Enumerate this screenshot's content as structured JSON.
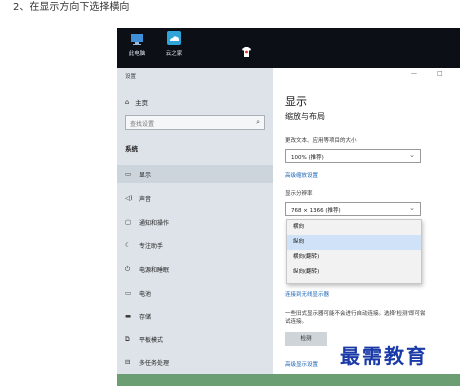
{
  "caption": "2、在显示方向下选择横向",
  "desktop": {
    "icons": [
      {
        "label": "此电脑",
        "icon": "this-pc-icon",
        "color": "#3f8fd9"
      },
      {
        "label": "云之家",
        "icon": "cloud-app-icon",
        "color": "#2fa4d8"
      }
    ]
  },
  "settings": {
    "window_title": "设置",
    "home_label": "主页",
    "search_placeholder": "查找设置",
    "section_title": "系统",
    "nav_items": [
      {
        "label": "显示",
        "icon": "monitor-icon"
      },
      {
        "label": "声音",
        "icon": "speaker-icon"
      },
      {
        "label": "通知和操作",
        "icon": "notification-icon"
      },
      {
        "label": "专注助手",
        "icon": "moon-icon"
      },
      {
        "label": "电源和睡眠",
        "icon": "power-icon"
      },
      {
        "label": "电池",
        "icon": "battery-icon"
      },
      {
        "label": "存储",
        "icon": "storage-icon"
      },
      {
        "label": "平板模式",
        "icon": "tablet-icon"
      },
      {
        "label": "多任务处理",
        "icon": "multitask-icon"
      }
    ]
  },
  "display": {
    "title": "显示",
    "subtitle": "缩放与布局",
    "scale_label": "更改文本、应用等项目的大小",
    "scale_value": "100% (推荐)",
    "advanced_scaling_link": "高级缩放设置",
    "resolution_label": "显示分辨率",
    "resolution_value": "768 × 1366 (推荐)",
    "orientation_options": [
      "横向",
      "纵向",
      "横向(翻转)",
      "纵向(翻转)"
    ],
    "selected_orientation": "纵向",
    "wireless_link": "连接到无线显示器",
    "detect_note_line1": "一些旧式显示器可能不会进行自动连接。选择'检测'即可尝",
    "detect_note_line2": "试连接。",
    "detect_button": "检测",
    "advanced_display_link": "高级显示设置"
  },
  "watermark": "最需教育"
}
